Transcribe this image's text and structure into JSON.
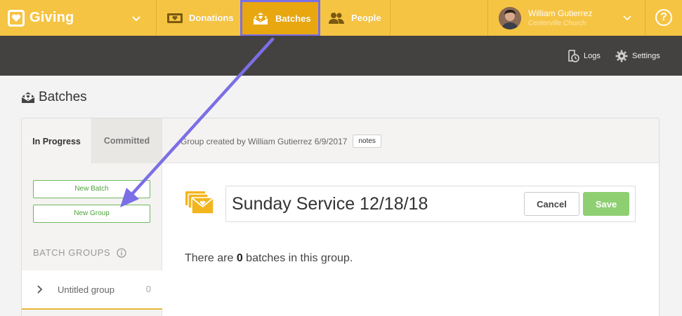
{
  "topnav": {
    "brand_name": "Giving",
    "tabs": [
      {
        "label": "Donations",
        "icon": "donations-icon"
      },
      {
        "label": "Batches",
        "icon": "batches-icon"
      },
      {
        "label": "People",
        "icon": "people-icon"
      }
    ],
    "user": {
      "name": "William Gutierrez",
      "church": "Centerville Church"
    },
    "help_label": "?"
  },
  "subbar": {
    "logs_label": "Logs",
    "settings_label": "Settings"
  },
  "page": {
    "title": "Batches"
  },
  "panel": {
    "tabs": [
      {
        "label": "In Progress"
      },
      {
        "label": "Committed"
      }
    ],
    "group_info": "Group created by William Gutierrez 6/9/2017",
    "notes_label": "notes",
    "sidebar": {
      "new_batch_label": "New Batch",
      "new_group_label": "New Group",
      "batch_groups_heading": "BATCH GROUPS",
      "groups": [
        {
          "name": "Untitled group",
          "count": "0"
        }
      ]
    },
    "main": {
      "group_name_value": "Sunday Service 12/18/18",
      "cancel_label": "Cancel",
      "save_label": "Save",
      "batch_count_prefix": "There are ",
      "batch_count": "0",
      "batch_count_suffix": " batches in this group."
    }
  },
  "colors": {
    "nav_bg": "#f6c443",
    "active_tab_bg": "#e9a70f",
    "highlight": "#7b6fe6",
    "subbar_bg": "#444240",
    "green": "#4ea33a",
    "save_bg": "#8ecf72"
  }
}
